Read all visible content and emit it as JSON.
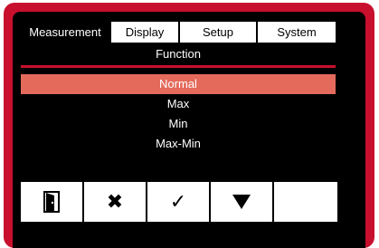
{
  "tabs": [
    {
      "label": "Measurement",
      "active": true
    },
    {
      "label": "Display",
      "active": false
    },
    {
      "label": "Setup",
      "active": false
    },
    {
      "label": "System",
      "active": false
    }
  ],
  "function_title": "Function",
  "options": [
    {
      "label": "Normal",
      "selected": true
    },
    {
      "label": "Max",
      "selected": false
    },
    {
      "label": "Min",
      "selected": false
    },
    {
      "label": "Max-Min",
      "selected": false
    }
  ],
  "softkeys": [
    {
      "icon": "exit-door-icon"
    },
    {
      "icon": "cancel-x-icon",
      "symbol": "✖"
    },
    {
      "icon": "confirm-check-icon",
      "symbol": "✓"
    },
    {
      "icon": "down-arrow-icon"
    },
    {
      "icon": "empty"
    }
  ],
  "colors": {
    "frame": "#c8102e",
    "screen": "#000000",
    "selection": "#e46a5c"
  }
}
